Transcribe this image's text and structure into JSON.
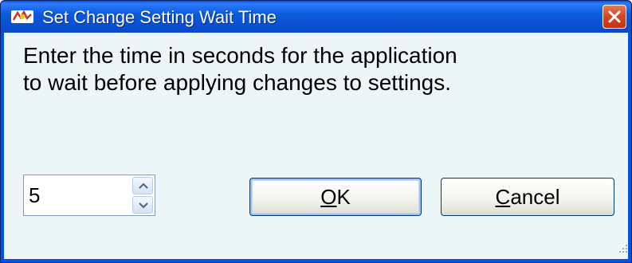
{
  "window": {
    "title": "Set Change Setting Wait Time",
    "icon": "app-icon",
    "close_icon": "close-icon"
  },
  "dialog": {
    "message_line1": "Enter the time in seconds for the application",
    "message_line2": "to wait before applying changes to settings."
  },
  "spinner": {
    "value": "5",
    "up_icon": "chevron-up-icon",
    "down_icon": "chevron-down-icon"
  },
  "buttons": {
    "ok_mnemonic": "O",
    "ok_rest": "K",
    "cancel_mnemonic": "C",
    "cancel_rest": "ancel"
  },
  "colors": {
    "titlebar": "#0a51d3",
    "client_background": "#ecf6f7",
    "close_button": "#d5451f",
    "button_border": "#003c74"
  }
}
